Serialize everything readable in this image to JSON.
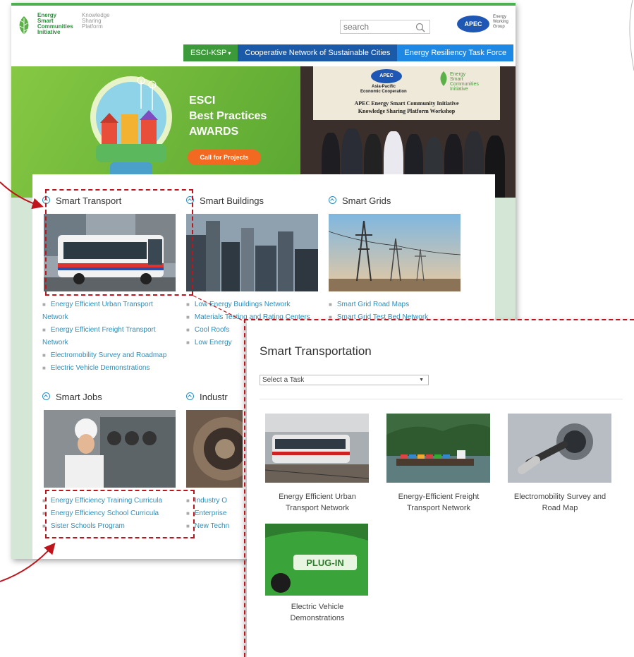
{
  "header": {
    "logo_lines": [
      "Energy",
      "Smart",
      "Communities",
      "Initiative"
    ],
    "ksp_lines": [
      "Knowledge",
      "Sharing",
      "Platform"
    ],
    "search_placeholder": "search",
    "apec_logo": "APEC",
    "apec_group_lines": [
      "Energy",
      "Working",
      "Group"
    ]
  },
  "nav": {
    "items": [
      "ESCI-KSP",
      "Cooperative Network of Sustainable Cities",
      "Energy Resiliency Task Force"
    ],
    "dropdown_caret": "▾"
  },
  "banner": {
    "esci": "ESCI",
    "best_practices": "Best Practices",
    "awards": "AWARDS",
    "cta": "Call for Projects",
    "photo": {
      "apec": "APEC",
      "asia_pacific": "Asia-Pacific",
      "economic_cooperation": "Economic Cooperation",
      "esci_lines": [
        "Energy",
        "Smart",
        "Communities",
        "Initiative"
      ],
      "workshop_line1": "APEC Energy Smart Community Initiative",
      "workshop_line2": "Knowledge Sharing Platform Workshop"
    }
  },
  "categories": [
    {
      "title": "Smart Transport",
      "links": [
        [
          "Energy Efficient Urban Transport",
          "Network"
        ],
        [
          "Energy Efficient Freight Transport",
          "Network"
        ],
        [
          "Electromobility Survey and Roadmap"
        ],
        [
          "Electric Vehicle Demonstrations"
        ]
      ]
    },
    {
      "title": "Smart Buildings",
      "links": [
        [
          "Low Energy Buildings Network"
        ],
        [
          "Materials Testing and Rating Centers"
        ],
        [
          "Cool Roofs"
        ],
        [
          "Low Energy"
        ]
      ]
    },
    {
      "title": "Smart Grids",
      "links": [
        [
          "Smart Grid Road Maps"
        ],
        [
          "Smart Grid Test Bed Network"
        ]
      ]
    },
    {
      "title": "Smart Jobs",
      "links": [
        [
          "Energy Efficiency Training Curricula"
        ],
        [
          "Energy Efficiency School Curricula"
        ],
        [
          "Sister Schools Program"
        ]
      ]
    },
    {
      "title": "Industr",
      "links": [
        [
          "Industry O"
        ],
        [
          "Enterprise"
        ],
        [
          "New Techn"
        ]
      ]
    }
  ],
  "panel": {
    "title": "Smart Transportation",
    "select_value": "Select a Task",
    "items": [
      [
        "Energy Efficient Urban",
        "Transport Network"
      ],
      [
        "Energy-Efficient Freight",
        "Transport Network"
      ],
      [
        "Electromobility Survey and",
        "Road Map"
      ],
      [
        "Electric Vehicle",
        "Demonstrations"
      ]
    ],
    "plugin_text": "PLUG-IN"
  },
  "colors": {
    "accent_green": "#4caf50",
    "nav_green": "#3d9a3a",
    "nav_blue_dark": "#1b5aa9",
    "nav_blue_light": "#1e88e5",
    "link_blue": "#2a8fbd",
    "highlight_red": "#c0141c",
    "side_band": "#d4e7d6"
  }
}
